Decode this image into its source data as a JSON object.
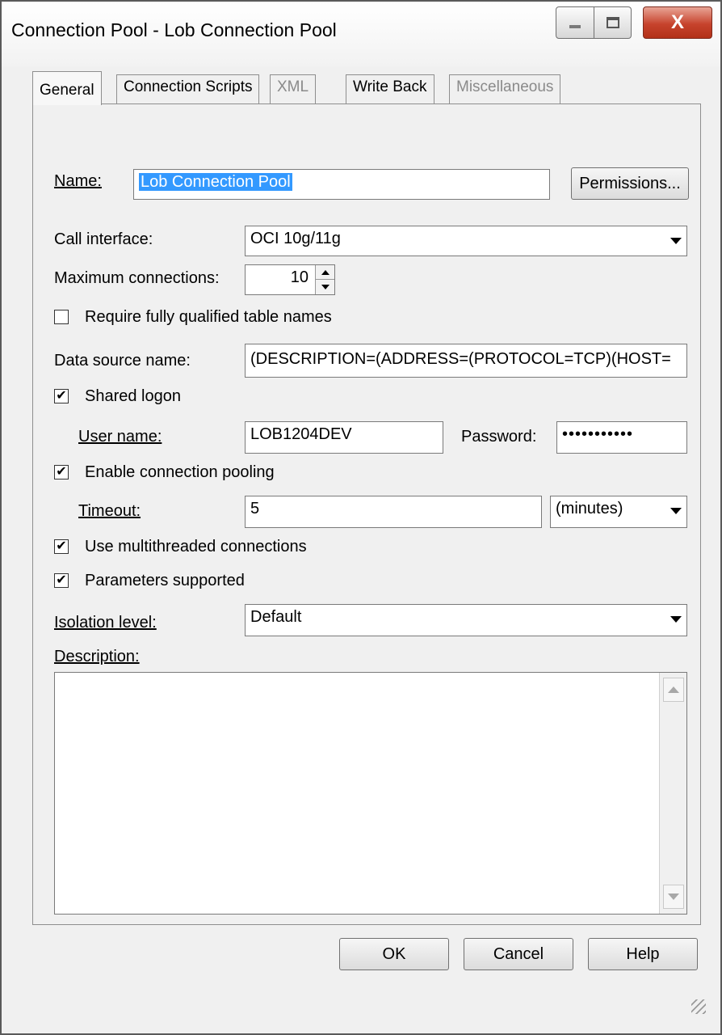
{
  "window": {
    "title": "Connection Pool - Lob Connection Pool",
    "close_symbol": "X"
  },
  "tabs": [
    {
      "label": "General",
      "state": "active"
    },
    {
      "label": "Connection Scripts",
      "state": "normal"
    },
    {
      "label": "XML",
      "state": "disabled"
    },
    {
      "label": "Write Back",
      "state": "normal"
    },
    {
      "label": "Miscellaneous",
      "state": "disabled"
    }
  ],
  "form": {
    "name": {
      "label": "Name:",
      "value": "Lob Connection Pool"
    },
    "permissions_button": "Permissions...",
    "call_interface": {
      "label": "Call interface:",
      "value": "OCI 10g/11g"
    },
    "max_connections": {
      "label": "Maximum connections:",
      "value": "10"
    },
    "require_fq": {
      "label": "Require fully qualified table names",
      "checked": false
    },
    "data_source": {
      "label": "Data source name:",
      "value": "(DESCRIPTION=(ADDRESS=(PROTOCOL=TCP)(HOST="
    },
    "shared_logon": {
      "label": "Shared logon",
      "checked": true
    },
    "user_name": {
      "label": "User name:",
      "value": "LOB1204DEV"
    },
    "password": {
      "label": "Password:",
      "value": "•••••••••••"
    },
    "enable_pooling": {
      "label": "Enable connection pooling",
      "checked": true
    },
    "timeout": {
      "label": "Timeout:",
      "value": "5",
      "unit": "(minutes)"
    },
    "multithreaded": {
      "label": "Use multithreaded connections",
      "checked": true
    },
    "parameters": {
      "label": "Parameters supported",
      "checked": true
    },
    "isolation": {
      "label": "Isolation level:",
      "value": "Default"
    },
    "description": {
      "label": "Description:",
      "value": ""
    }
  },
  "footer": {
    "ok": "OK",
    "cancel": "Cancel",
    "help": "Help"
  },
  "check_mark": "✔"
}
